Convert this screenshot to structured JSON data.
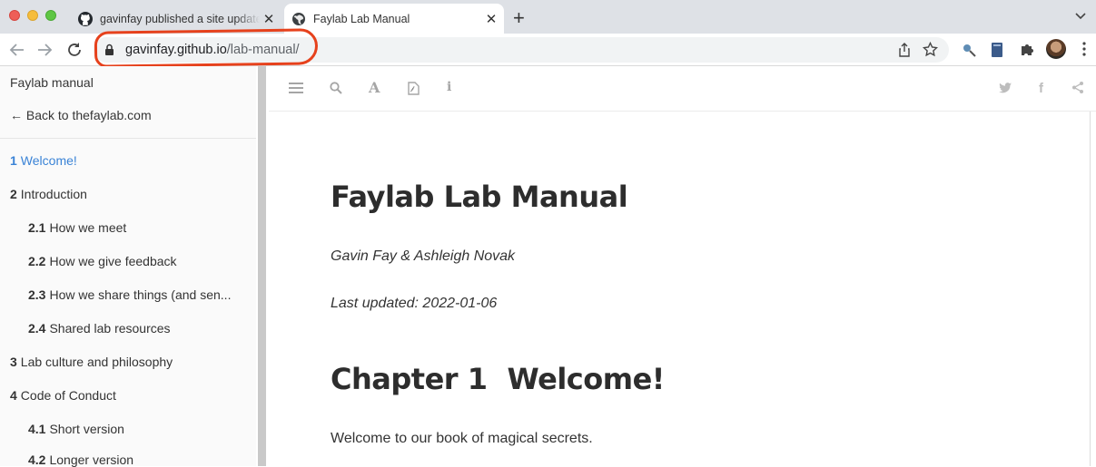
{
  "browser": {
    "tabs": [
      {
        "title": "gavinfay published a site update",
        "icon": "github-icon",
        "active": false
      },
      {
        "title": "Faylab Lab Manual",
        "icon": "globe-icon",
        "active": true
      }
    ],
    "url_host": "gavinfay.github.io",
    "url_path": "/lab-manual/",
    "annotation_color": "#e6411c"
  },
  "sidebar": {
    "title": "Faylab manual",
    "back_link": "← Back to thefaylab.com",
    "toc": [
      {
        "num": "1",
        "label": "Welcome!",
        "active": true
      },
      {
        "num": "2",
        "label": "Introduction"
      },
      {
        "num": "2.1",
        "label": "How we meet"
      },
      {
        "num": "2.2",
        "label": "How we give feedback"
      },
      {
        "num": "2.3",
        "label": "How we share things (and sen..."
      },
      {
        "num": "2.4",
        "label": "Shared lab resources"
      },
      {
        "num": "3",
        "label": "Lab culture and philosophy"
      },
      {
        "num": "4",
        "label": "Code of Conduct"
      },
      {
        "num": "4.1",
        "label": "Short version"
      },
      {
        "num": "4.2",
        "label": "Longer version"
      }
    ],
    "active_color": "#3a83d6"
  },
  "book": {
    "title": "Faylab Lab Manual",
    "author": "Gavin Fay & Ashleigh Novak",
    "updated": "Last updated: 2022-01-06",
    "chapter_num": "Chapter 1",
    "chapter_title": "Welcome!",
    "intro": "Welcome to our book of magical secrets."
  }
}
